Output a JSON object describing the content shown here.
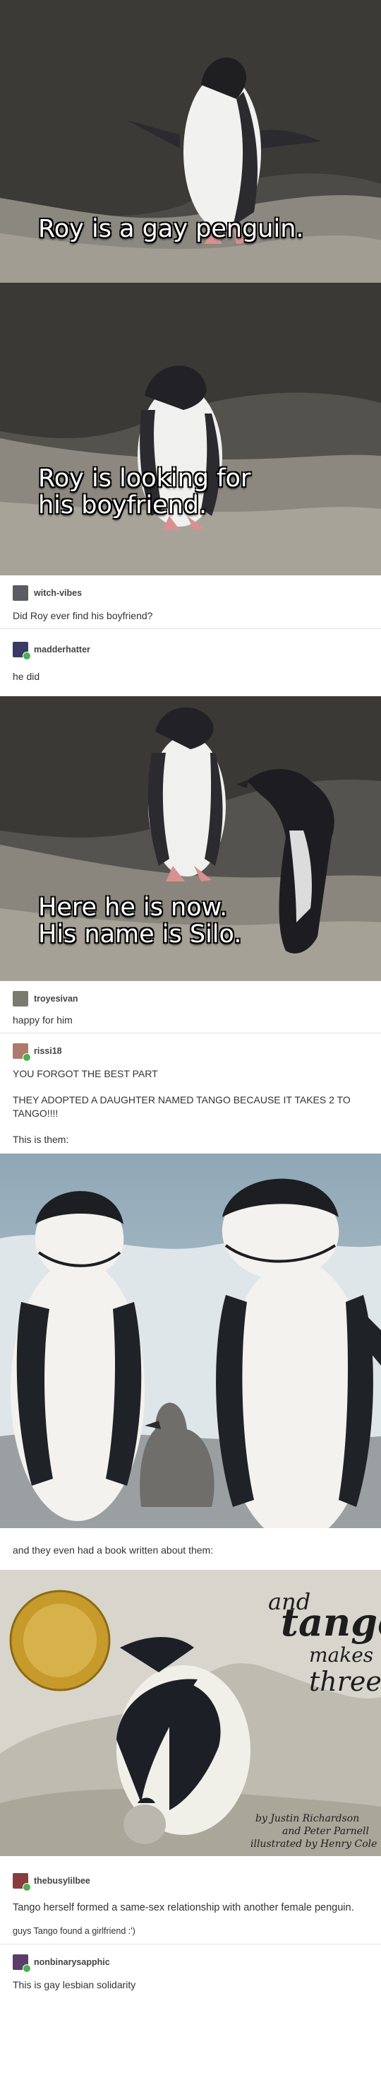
{
  "panels": {
    "panel1_caption": "Roy is a gay penguin.",
    "panel2_caption": "Roy is looking for\nhis boyfriend.",
    "panel3_caption": "Here he is now.\nHis name is Silo."
  },
  "posts": [
    {
      "username": "witch-vibes",
      "text": "Did Roy ever find his boyfriend?"
    },
    {
      "username": "madderhatter",
      "text": "he did"
    },
    {
      "username": "troyesivan",
      "text": "happy for him"
    },
    {
      "username": "rissi18",
      "paragraphs": [
        "YOU FORGOT THE BEST PART",
        "THEY ADOPTED A DAUGHTER NAMED TANGO BECAUSE IT TAKES 2 TO TANGO!!!!",
        "This is them:"
      ],
      "after_photo": "and they even had a book written about them:"
    },
    {
      "username": "thebusylilbee",
      "paragraphs": [
        "Tango herself formed a same-sex relationship with another female penguin.",
        "guys Tango found a girlfriend :')"
      ]
    },
    {
      "username": "nonbinarysapphic",
      "text": "This is gay lesbian solidarity"
    }
  ],
  "book": {
    "title_and": "and",
    "title_tango": "tango",
    "title_makes": "makes",
    "title_three": "three",
    "credit_line1": "by Justin Richardson",
    "credit_line2": "and Peter Parnell",
    "credit_line3": "illustrated by Henry Cole"
  },
  "colors": {
    "badge_green": "#4caf50",
    "divider": "#e3e3e3"
  }
}
